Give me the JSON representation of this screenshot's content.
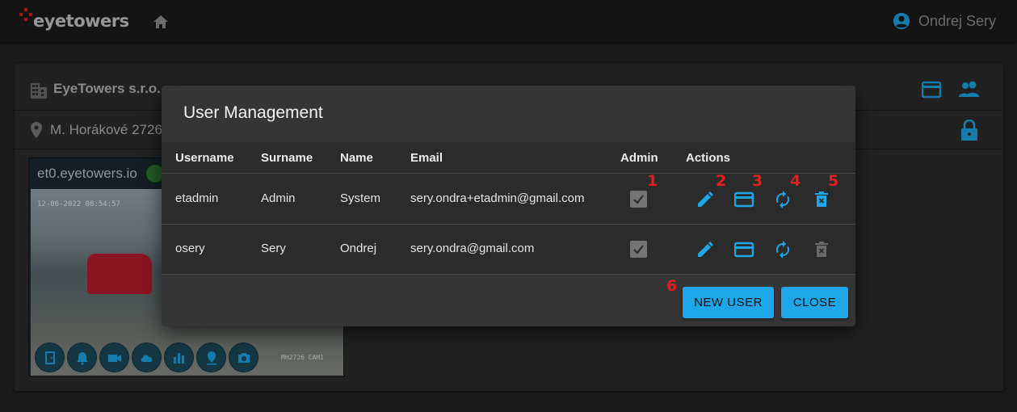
{
  "app": {
    "logo_text": "eyetowers",
    "user_name": "Ondrej Sery"
  },
  "card": {
    "company": "EyeTowers s.r.o.",
    "address": "M. Horákové 2726"
  },
  "camera": {
    "title": "et0.eyetowers.io",
    "timestamp": "12-06-2022 08:54:57",
    "cam_label": "MH2726 CAM1",
    "buttons": [
      "door-icon",
      "alarm-bell-icon",
      "video-camera-icon",
      "cloud-icon",
      "bar-chart-icon",
      "location-pin-icon",
      "camera-icon"
    ]
  },
  "dialog": {
    "title": "User Management",
    "columns": {
      "username": "Username",
      "surname": "Surname",
      "name": "Name",
      "email": "Email",
      "admin": "Admin",
      "actions": "Actions"
    },
    "rows": [
      {
        "username": "etadmin",
        "surname": "Admin",
        "name": "System",
        "email": "sery.ondra+etadmin@gmail.com",
        "admin": true
      },
      {
        "username": "osery",
        "surname": "Sery",
        "name": "Ondrej",
        "email": "sery.ondra@gmail.com",
        "admin": true
      }
    ],
    "markers": [
      "1",
      "2",
      "3",
      "4",
      "5",
      "6"
    ],
    "new_user_label": "NEW USER",
    "close_label": "CLOSE"
  },
  "colors": {
    "accent": "#1ea6e8",
    "marker": "#e02020",
    "background": "#232323",
    "dialog": "#353535"
  }
}
